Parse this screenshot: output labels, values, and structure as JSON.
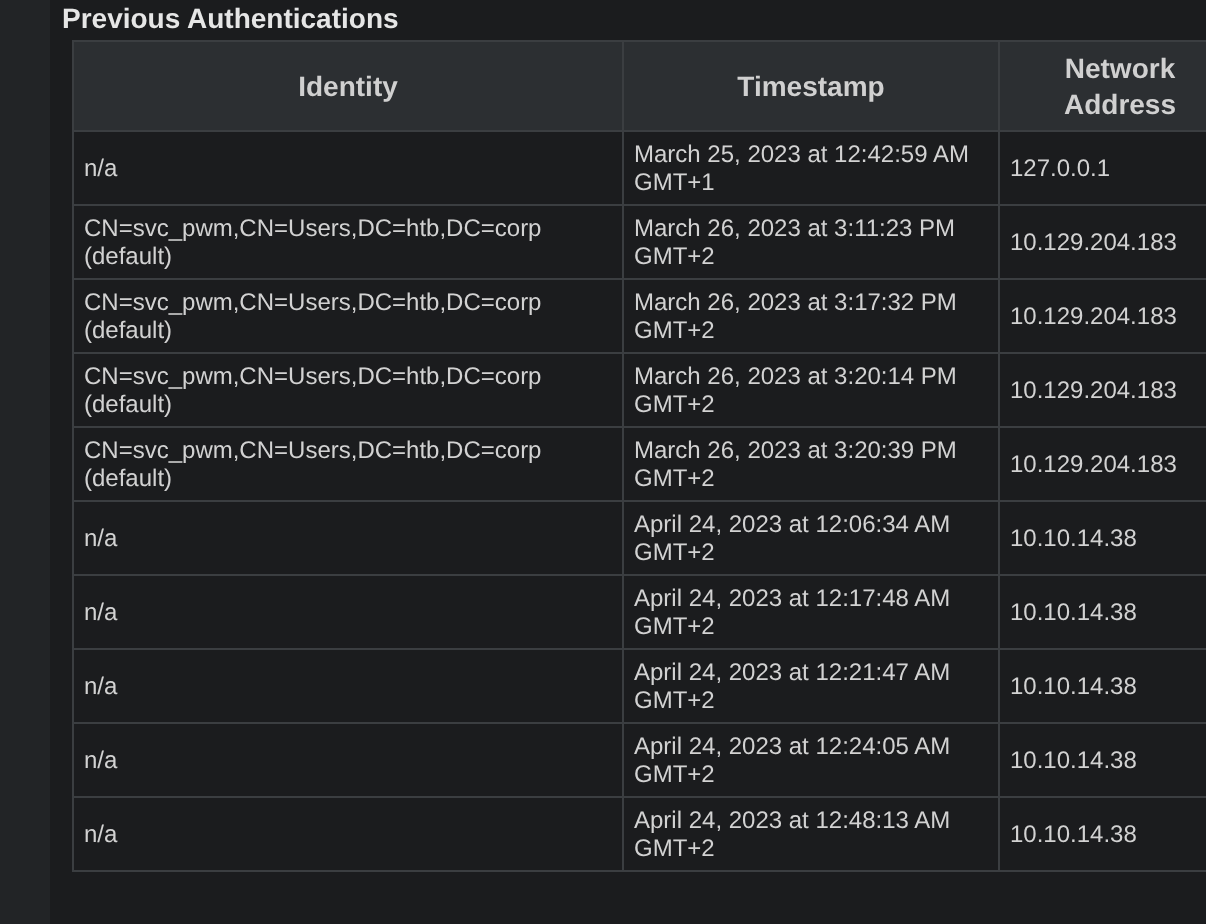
{
  "section_title": "Previous Authentications",
  "table": {
    "columns": [
      "Identity",
      "Timestamp",
      "Network Address"
    ],
    "rows": [
      {
        "identity": "n/a",
        "timestamp": "March 25, 2023 at 12:42:59 AM GMT+1",
        "address": "127.0.0.1"
      },
      {
        "identity": "CN=svc_pwm,CN=Users,DC=htb,DC=corp\n(default)",
        "timestamp": "March 26, 2023 at 3:11:23 PM GMT+2",
        "address": "10.129.204.183"
      },
      {
        "identity": "CN=svc_pwm,CN=Users,DC=htb,DC=corp\n(default)",
        "timestamp": "March 26, 2023 at 3:17:32 PM GMT+2",
        "address": "10.129.204.183"
      },
      {
        "identity": "CN=svc_pwm,CN=Users,DC=htb,DC=corp\n(default)",
        "timestamp": "March 26, 2023 at 3:20:14 PM GMT+2",
        "address": "10.129.204.183"
      },
      {
        "identity": "CN=svc_pwm,CN=Users,DC=htb,DC=corp\n(default)",
        "timestamp": "March 26, 2023 at 3:20:39 PM GMT+2",
        "address": "10.129.204.183"
      },
      {
        "identity": "n/a",
        "timestamp": "April 24, 2023 at 12:06:34 AM GMT+2",
        "address": "10.10.14.38"
      },
      {
        "identity": "n/a",
        "timestamp": "April 24, 2023 at 12:17:48 AM GMT+2",
        "address": "10.10.14.38"
      },
      {
        "identity": "n/a",
        "timestamp": "April 24, 2023 at 12:21:47 AM GMT+2",
        "address": "10.10.14.38"
      },
      {
        "identity": "n/a",
        "timestamp": "April 24, 2023 at 12:24:05 AM GMT+2",
        "address": "10.10.14.38"
      },
      {
        "identity": "n/a",
        "timestamp": "April 24, 2023 at 12:48:13 AM GMT+2",
        "address": "10.10.14.38"
      }
    ]
  }
}
